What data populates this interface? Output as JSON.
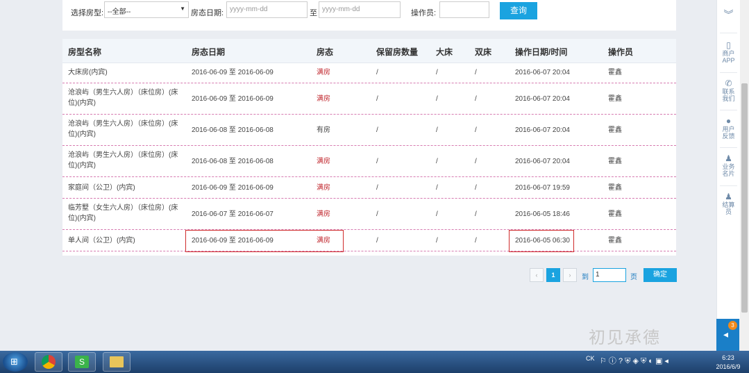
{
  "filters": {
    "room_type_label": "选择房型:",
    "room_type_value": "--全部--",
    "date_label": "房态日期:",
    "date_from_placeholder": "yyyy-mm-dd",
    "date_sep": "至",
    "date_to_placeholder": "yyyy-mm-dd",
    "operator_label": "操作员:",
    "operator_value": "",
    "query_button": "查询"
  },
  "table": {
    "headers": [
      "房型名称",
      "房态日期",
      "房态",
      "保留房数量",
      "大床",
      "双床",
      "操作日期/时间",
      "操作员"
    ],
    "rows": [
      {
        "name": "大床房(内宾)",
        "date": "2016-06-09 至 2016-06-09",
        "status": "满房",
        "reserved": "/",
        "big": "/",
        "twin": "/",
        "op_time": "2016-06-07 20:04",
        "operator": "霍鑫"
      },
      {
        "name": "沧浪屿（男生六人房）（床位房）(床位)(内宾)",
        "date": "2016-06-09 至 2016-06-09",
        "status": "满房",
        "reserved": "/",
        "big": "/",
        "twin": "/",
        "op_time": "2016-06-07 20:04",
        "operator": "霍鑫"
      },
      {
        "name": "沧浪屿（男生六人房）（床位房）(床位)(内宾)",
        "date": "2016-06-08 至 2016-06-08",
        "status": "有房",
        "reserved": "/",
        "big": "/",
        "twin": "/",
        "op_time": "2016-06-07 20:04",
        "operator": "霍鑫"
      },
      {
        "name": "沧浪屿（男生六人房）（床位房）(床位)(内宾)",
        "date": "2016-06-08 至 2016-06-08",
        "status": "满房",
        "reserved": "/",
        "big": "/",
        "twin": "/",
        "op_time": "2016-06-07 20:04",
        "operator": "霍鑫"
      },
      {
        "name": "家庭间（公卫）(内宾)",
        "date": "2016-06-09 至 2016-06-09",
        "status": "满房",
        "reserved": "/",
        "big": "/",
        "twin": "/",
        "op_time": "2016-06-07 19:59",
        "operator": "霍鑫"
      },
      {
        "name": "临芳墅（女生六人房）（床位房）(床位)(内宾)",
        "date": "2016-06-07 至 2016-06-07",
        "status": "满房",
        "reserved": "/",
        "big": "/",
        "twin": "/",
        "op_time": "2016-06-05 18:46",
        "operator": "霍鑫"
      },
      {
        "name": "单人间（公卫）(内宾)",
        "date": "2016-06-09 至 2016-06-09",
        "status": "满房",
        "reserved": "/",
        "big": "/",
        "twin": "/",
        "op_time": "2016-06-05 06:30",
        "operator": "霍鑫"
      }
    ]
  },
  "pagination": {
    "prev": "‹",
    "current": "1",
    "next": "›",
    "goto_label": "到",
    "page_input": "1",
    "page_suffix": "页",
    "confirm_button": "确定"
  },
  "sidebar": {
    "collapse_icon": "double-chevron-down-icon",
    "items": [
      {
        "icon": "phone-icon",
        "label1": "商户",
        "label2": "APP"
      },
      {
        "icon": "call-icon",
        "label1": "联系",
        "label2": "我们"
      },
      {
        "icon": "chat-icon",
        "label1": "用户",
        "label2": "反馈"
      },
      {
        "icon": "person-icon",
        "label1": "业务",
        "label2": "名片"
      },
      {
        "icon": "person-icon",
        "label1": "结算",
        "label2": "员"
      }
    ],
    "badge": "3"
  },
  "watermark": "初见承德",
  "taskbar": {
    "ime": "CK",
    "time": "6:23",
    "date": "2016/6/9"
  },
  "colors": {
    "accent": "#1aa3e0",
    "status_full": "#c0262d",
    "highlight_box": "#cf2b2b"
  }
}
